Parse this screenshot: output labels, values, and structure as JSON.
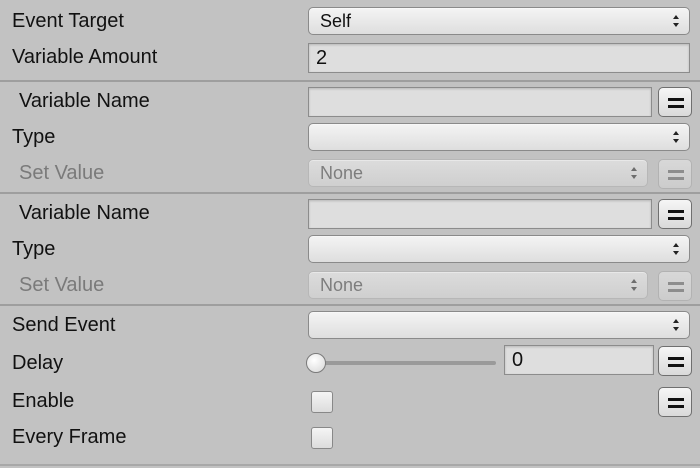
{
  "rows": {
    "event_target": {
      "label": "Event Target",
      "value": "Self"
    },
    "variable_amount": {
      "label": "Variable Amount",
      "value": "2"
    },
    "variable1": {
      "name_label": "Variable Name",
      "name_value": "",
      "type_label": "Type",
      "type_value": "",
      "set_value_label": "Set Value",
      "set_value": "None"
    },
    "variable2": {
      "name_label": "Variable Name",
      "name_value": "",
      "type_label": "Type",
      "type_value": "",
      "set_value_label": "Set Value",
      "set_value": "None"
    },
    "send_event": {
      "label": "Send Event",
      "value": ""
    },
    "delay": {
      "label": "Delay",
      "value": "0",
      "slider_fraction": 0
    },
    "enable": {
      "label": "Enable",
      "checked": false
    },
    "every_frame": {
      "label": "Every Frame",
      "checked": false
    }
  },
  "icons": {
    "popup_arrows": "up-down-chevron-icon",
    "variable_toggle": "equals-icon"
  }
}
